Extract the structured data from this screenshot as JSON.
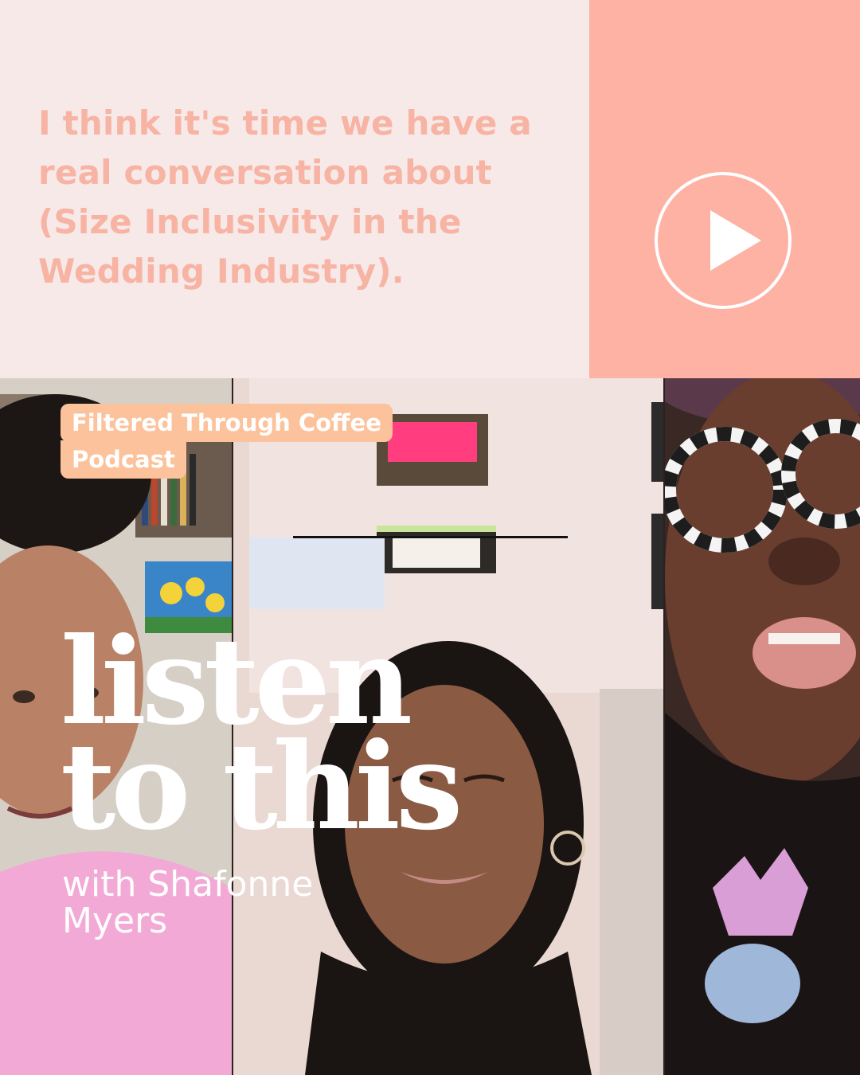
{
  "quote": "I think it's time we have a real conversation about (Size Inclusivity in the Wedding Industry).",
  "badge": {
    "line1": "Filtered Through Coffee",
    "line2": "Podcast"
  },
  "headline": {
    "line1": "listen",
    "line2": "to this"
  },
  "byline": "with Shafonne Myers",
  "icons": {
    "play": "play-icon"
  },
  "colors": {
    "background": "#f7e9e7",
    "accent": "#fdb2a4",
    "quote_text": "#f7b3a3",
    "badge": "#fbc29b"
  }
}
